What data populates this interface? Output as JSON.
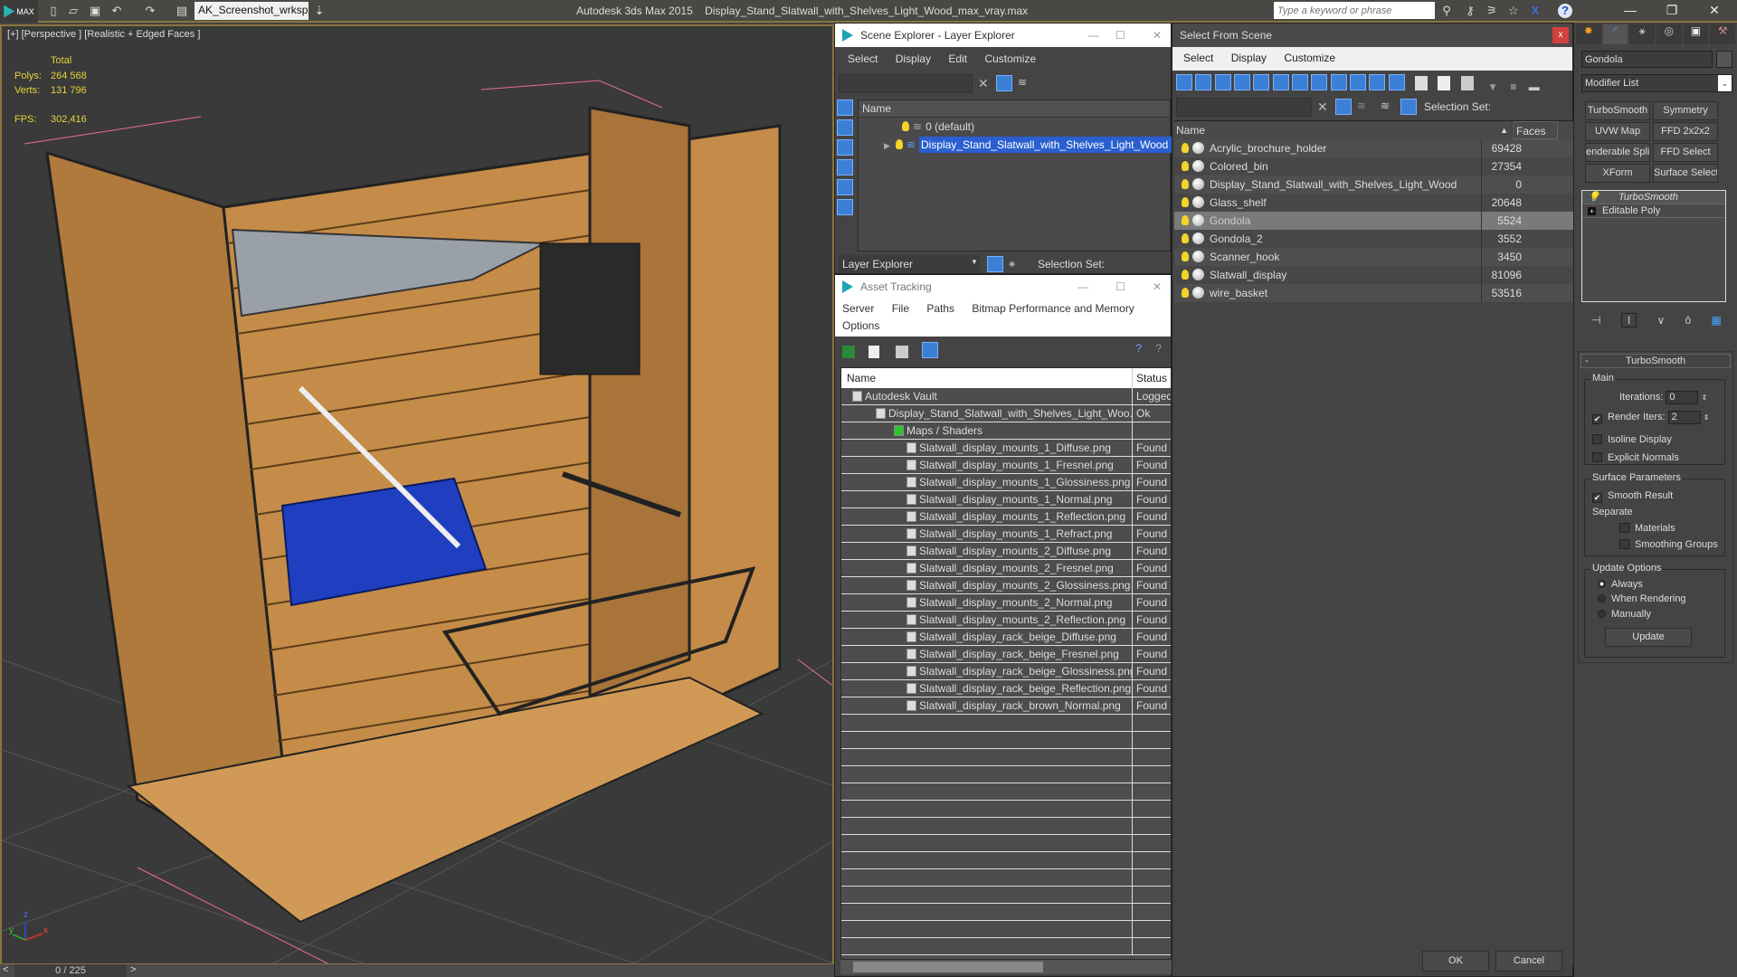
{
  "app": {
    "title": "Autodesk 3ds Max  2015",
    "file": "Display_Stand_Slatwall_with_Shelves_Light_Wood_max_vray.max",
    "logo_text": "MAX",
    "workspace": "AK_Screenshot_wrksp",
    "search_placeholder": "Type a keyword or phrase"
  },
  "viewport": {
    "label": "[+] [Perspective ] [Realistic + Edged Faces ]",
    "stats": {
      "total_label": "Total",
      "polys_label": "Polys:",
      "polys": "264 568",
      "verts_label": "Verts:",
      "verts": "131 796",
      "fps_label": "FPS:",
      "fps": "302,416"
    },
    "axis": {
      "x": "x",
      "y": "y",
      "z": "z"
    }
  },
  "timeslider": {
    "value": "0 / 225",
    "prev": "<",
    "next": ">"
  },
  "scene_explorer": {
    "title": "Scene Explorer - Layer Explorer",
    "menu": [
      "Select",
      "Display",
      "Edit",
      "Customize"
    ],
    "column": "Name",
    "layers": [
      {
        "name": "0 (default)",
        "selected": false
      },
      {
        "name": "Display_Stand_Slatwall_with_Shelves_Light_Wood",
        "selected": true
      }
    ],
    "footer_dropdown": "Layer Explorer",
    "selection_set_label": "Selection Set:"
  },
  "asset_tracking": {
    "title": "Asset Tracking",
    "menu": [
      "Server",
      "File",
      "Paths",
      "Bitmap Performance and Memory",
      "Options"
    ],
    "columns": [
      "Name",
      "Status"
    ],
    "rows": [
      {
        "name": "Autodesk Vault",
        "status": "Logged",
        "level": 1
      },
      {
        "name": "Display_Stand_Slatwall_with_Shelves_Light_Woo...",
        "status": "Ok",
        "level": 2
      },
      {
        "name": "Maps / Shaders",
        "status": "",
        "level": 3
      },
      {
        "name": "Slatwall_display_mounts_1_Diffuse.png",
        "status": "Found",
        "level": 4
      },
      {
        "name": "Slatwall_display_mounts_1_Fresnel.png",
        "status": "Found",
        "level": 4
      },
      {
        "name": "Slatwall_display_mounts_1_Glossiness.png",
        "status": "Found",
        "level": 4
      },
      {
        "name": "Slatwall_display_mounts_1_Normal.png",
        "status": "Found",
        "level": 4
      },
      {
        "name": "Slatwall_display_mounts_1_Reflection.png",
        "status": "Found",
        "level": 4
      },
      {
        "name": "Slatwall_display_mounts_1_Refract.png",
        "status": "Found",
        "level": 4
      },
      {
        "name": "Slatwall_display_mounts_2_Diffuse.png",
        "status": "Found",
        "level": 4
      },
      {
        "name": "Slatwall_display_mounts_2_Fresnel.png",
        "status": "Found",
        "level": 4
      },
      {
        "name": "Slatwall_display_mounts_2_Glossiness.png",
        "status": "Found",
        "level": 4
      },
      {
        "name": "Slatwall_display_mounts_2_Normal.png",
        "status": "Found",
        "level": 4
      },
      {
        "name": "Slatwall_display_mounts_2_Reflection.png",
        "status": "Found",
        "level": 4
      },
      {
        "name": "Slatwall_display_rack_beige_Diffuse.png",
        "status": "Found",
        "level": 4
      },
      {
        "name": "Slatwall_display_rack_beige_Fresnel.png",
        "status": "Found",
        "level": 4
      },
      {
        "name": "Slatwall_display_rack_beige_Glossiness.png",
        "status": "Found",
        "level": 4
      },
      {
        "name": "Slatwall_display_rack_beige_Reflection.png",
        "status": "Found",
        "level": 4
      },
      {
        "name": "Slatwall_display_rack_brown_Normal.png",
        "status": "Found",
        "level": 4
      }
    ]
  },
  "select_from_scene": {
    "title": "Select From Scene",
    "menu": [
      "Select",
      "Display",
      "Customize"
    ],
    "selection_set_label": "Selection Set:",
    "columns": [
      "Name",
      "Faces"
    ],
    "objects": [
      {
        "name": "Acrylic_brochure_holder",
        "faces": "69428",
        "selected": false
      },
      {
        "name": "Colored_bin",
        "faces": "27354",
        "selected": false
      },
      {
        "name": "Display_Stand_Slatwall_with_Shelves_Light_Wood",
        "faces": "0",
        "selected": false
      },
      {
        "name": "Glass_shelf",
        "faces": "20648",
        "selected": false
      },
      {
        "name": "Gondola",
        "faces": "5524",
        "selected": true
      },
      {
        "name": "Gondola_2",
        "faces": "3552",
        "selected": false
      },
      {
        "name": "Scanner_hook",
        "faces": "3450",
        "selected": false
      },
      {
        "name": "Slatwall_display",
        "faces": "81096",
        "selected": false
      },
      {
        "name": "wire_basket",
        "faces": "53516",
        "selected": false
      }
    ],
    "ok": "OK",
    "cancel": "Cancel"
  },
  "command_panel": {
    "object_name": "Gondola",
    "modifier_list": "Modifier List",
    "modifier_buttons": [
      "TurboSmooth",
      "Symmetry",
      "UVW Map",
      "FFD 2x2x2",
      "enderable Splin",
      "FFD Select",
      "XForm",
      "Surface Select"
    ],
    "stack": [
      "TurboSmooth",
      "Editable Poly"
    ],
    "turbosmooth": {
      "rollout": "TurboSmooth",
      "main": "Main",
      "iterations_label": "Iterations:",
      "iterations": "0",
      "render_iters_label": "Render Iters:",
      "render_iters": "2",
      "render_iters_checked": true,
      "isoline_display": "Isoline Display",
      "explicit_normals": "Explicit Normals",
      "surface_params": "Surface Parameters",
      "smooth_result": "Smooth Result",
      "separate": "Separate",
      "materials": "Materials",
      "smoothing_groups": "Smoothing Groups",
      "update_options": "Update Options",
      "always": "Always",
      "when_rendering": "When Rendering",
      "manually": "Manually",
      "update_button": "Update"
    }
  },
  "colors": {
    "accent": "#3c7fd6",
    "viewport_border": "#8a7540",
    "stat_text": "#e8d23a",
    "selection": "#2a5fd0"
  }
}
